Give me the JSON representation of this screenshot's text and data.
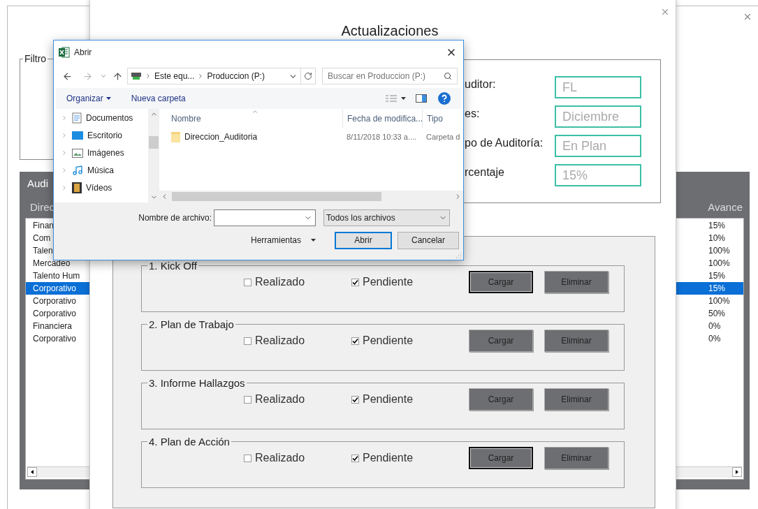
{
  "back_window": {
    "filters_title": "Filtro",
    "panel_title": "Audi",
    "columns": [
      "Direc",
      "Avance"
    ],
    "rows": [
      {
        "column_1": "Finan",
        "avance": "15%",
        "selected": false
      },
      {
        "column_1": "Com",
        "avance": "10%",
        "selected": false
      },
      {
        "column_1": "Talen",
        "avance": "100%",
        "selected": false
      },
      {
        "column_1": "Mercadeo",
        "avance": "100%",
        "selected": false
      },
      {
        "column_1": "Talento Hum",
        "avance": "15%",
        "selected": false
      },
      {
        "column_1": "Corporativo",
        "avance": "15%",
        "selected": true
      },
      {
        "column_1": "Corporativo",
        "avance": "100%",
        "selected": false
      },
      {
        "column_1": "Corporativo",
        "avance": "50%",
        "selected": false
      },
      {
        "column_1": "Financiera",
        "avance": "0%",
        "selected": false
      },
      {
        "column_1": "Corporativo",
        "avance": "0%",
        "selected": false
      }
    ]
  },
  "form": {
    "title": "Actualizaciones",
    "fields": [
      {
        "label": "uditor:",
        "value": "FL"
      },
      {
        "label": "es:",
        "value": "Diciembre"
      },
      {
        "label": "po de Auditoría:",
        "value": "En Plan"
      },
      {
        "label": "rcentaje",
        "value": "15%"
      }
    ],
    "stages": [
      {
        "title": "1. Kick Off",
        "options": [
          {
            "label": "Realizado",
            "checked": false
          },
          {
            "label": "Pendiente",
            "checked": true
          }
        ],
        "buttons": [
          {
            "label": "Cargar",
            "focused": true
          },
          {
            "label": "Eliminar",
            "focused": false
          }
        ]
      },
      {
        "title": "2. Plan de Trabajo",
        "options": [
          {
            "label": "Realizado",
            "checked": false
          },
          {
            "label": "Pendiente",
            "checked": true
          }
        ],
        "buttons": [
          {
            "label": "Cargar",
            "focused": false
          },
          {
            "label": "Eliminar",
            "focused": false
          }
        ]
      },
      {
        "title": "3. Informe Hallazgos",
        "options": [
          {
            "label": "Realizado",
            "checked": false
          },
          {
            "label": "Pendiente",
            "checked": true
          }
        ],
        "buttons": [
          {
            "label": "Cargar",
            "focused": false
          },
          {
            "label": "Eliminar",
            "focused": false
          }
        ]
      },
      {
        "title": "4. Plan de Acción",
        "options": [
          {
            "label": "Realizado",
            "checked": false
          },
          {
            "label": "Pendiente",
            "checked": true
          }
        ],
        "buttons": [
          {
            "label": "Cargar",
            "focused": true
          },
          {
            "label": "Eliminar",
            "focused": false
          }
        ]
      }
    ]
  },
  "dialog": {
    "title": "Abrir",
    "breadcrumbs": [
      "Este equ...",
      "Produccion (P:)"
    ],
    "search": {
      "placeholder": "Buscar en Produccion (P:)"
    },
    "organize": "Organizar",
    "new_folder": "Nueva carpeta",
    "nav_items": [
      {
        "label": "Documentos",
        "kind": "documents"
      },
      {
        "label": "Escritorio",
        "kind": "desktop"
      },
      {
        "label": "Imágenes",
        "kind": "images"
      },
      {
        "label": "Música",
        "kind": "music"
      },
      {
        "label": "Vídeos",
        "kind": "videos"
      }
    ],
    "columns": [
      "Nombre",
      "Fecha de modifica...",
      "Tipo"
    ],
    "files": [
      {
        "name": "Direccion_Auditoria",
        "modified": "8/11/2018 10:33 a....",
        "type": "Carpeta d"
      }
    ],
    "filename_label": "Nombre de archivo:",
    "filter": "Todos los archivos",
    "tools": "Herramientas",
    "buttons": [
      {
        "label": "Abrir",
        "primary": true
      },
      {
        "label": "Cancelar",
        "primary": false
      }
    ]
  }
}
